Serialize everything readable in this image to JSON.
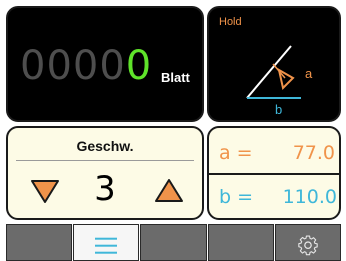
{
  "counter": {
    "dim_digits": "0000",
    "lit_digit": "0",
    "unit": "Blatt"
  },
  "angle": {
    "hold_label": "Hold",
    "label_a": "a",
    "label_b": "b"
  },
  "speed": {
    "title": "Geschw.",
    "value": "3",
    "icons": {
      "decrease": "triangle-down-icon",
      "increase": "triangle-up-icon"
    }
  },
  "values": {
    "a_label": "a =",
    "a_value": "77.0",
    "b_label": "b =",
    "b_value": "110.0"
  },
  "toolbar": {
    "buttons": [
      {
        "icon": ""
      },
      {
        "icon": "menu-icon",
        "active": true
      },
      {
        "icon": ""
      },
      {
        "icon": ""
      },
      {
        "icon": "gear-icon"
      }
    ]
  },
  "colors": {
    "accent_orange": "#f0934a",
    "accent_blue": "#3fb7d9",
    "digit_green": "#5fe32a",
    "panel_light": "#fdfbe6"
  }
}
